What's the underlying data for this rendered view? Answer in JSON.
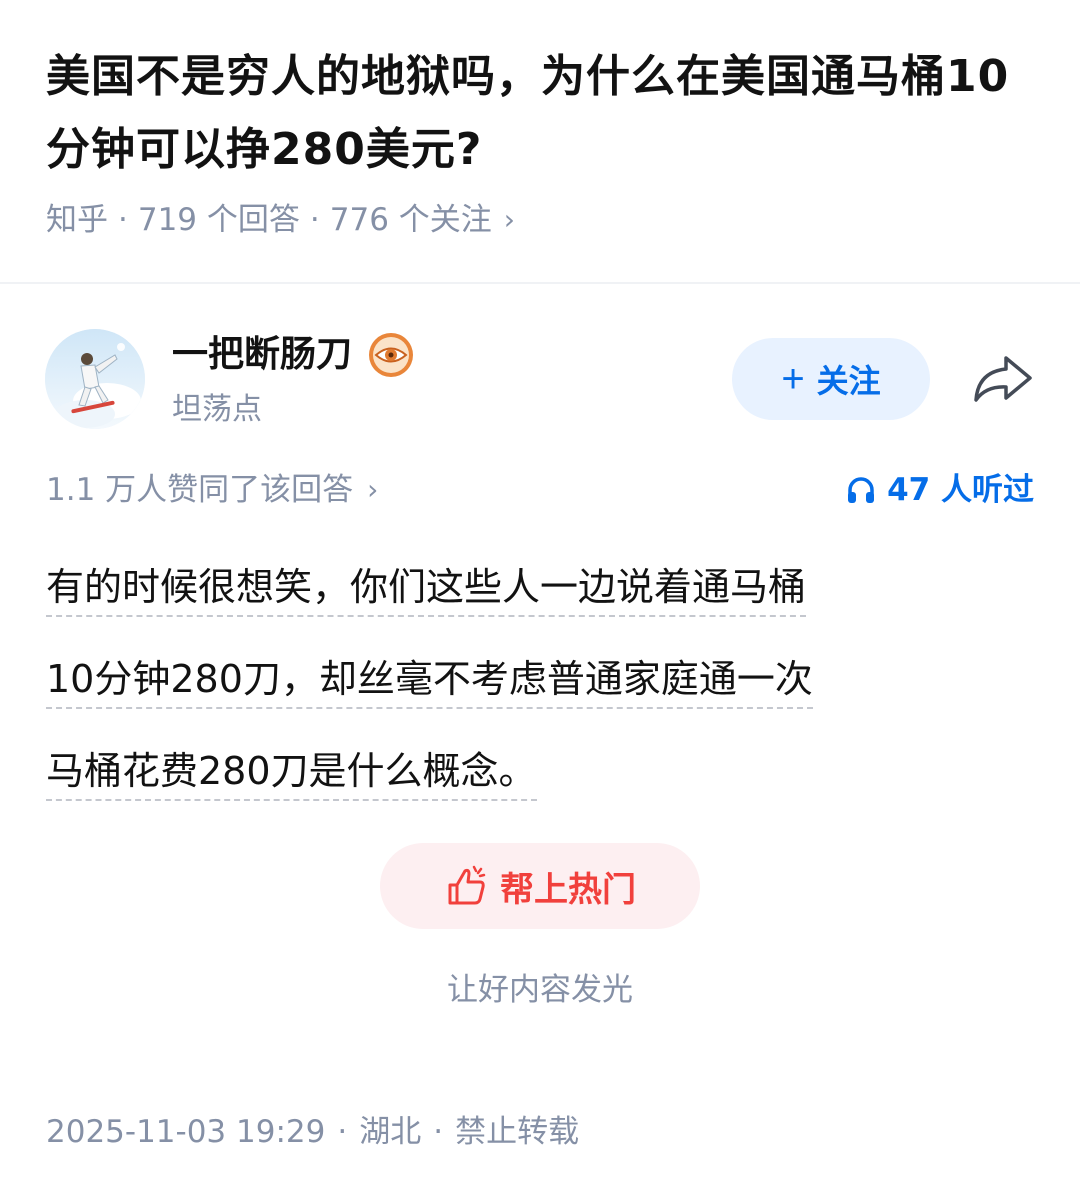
{
  "question": {
    "title": "美国不是穷人的地狱吗，为什么在美国通马桶10分钟可以挣280美元?",
    "source": "知乎",
    "answers": "719 个回答",
    "followers": "776 个关注",
    "separator": "·",
    "chevron": "›"
  },
  "author": {
    "name": "一把断肠刀",
    "bio": "坦荡点",
    "avatar_icon": "user-avatar-photo",
    "badge_icon": "eye-badge-icon",
    "follow_plus": "+",
    "follow_label": "关注",
    "share_icon": "share-arrow-icon"
  },
  "stats": {
    "votes": "1.1 万人赞同了该回答",
    "listens": "47 人听过",
    "headphone_icon": "headphone-icon"
  },
  "answer": {
    "lines": [
      "有的时候很想笑，你们这些人一边说着通马桶",
      "10分钟280刀，却丝毫不考虑普通家庭通一次",
      "马桶花费280刀是什么概念。"
    ]
  },
  "boost": {
    "label": "帮上热门",
    "icon": "thumbs-up-icon",
    "subtitle": "让好内容发光"
  },
  "footer": {
    "datetime": "2025-11-03 19:29",
    "location": "湖北",
    "copyright": "禁止转载"
  },
  "colors": {
    "accent_blue": "#056de8",
    "boost_red": "#f1403c",
    "meta_gray": "#8590a6"
  }
}
